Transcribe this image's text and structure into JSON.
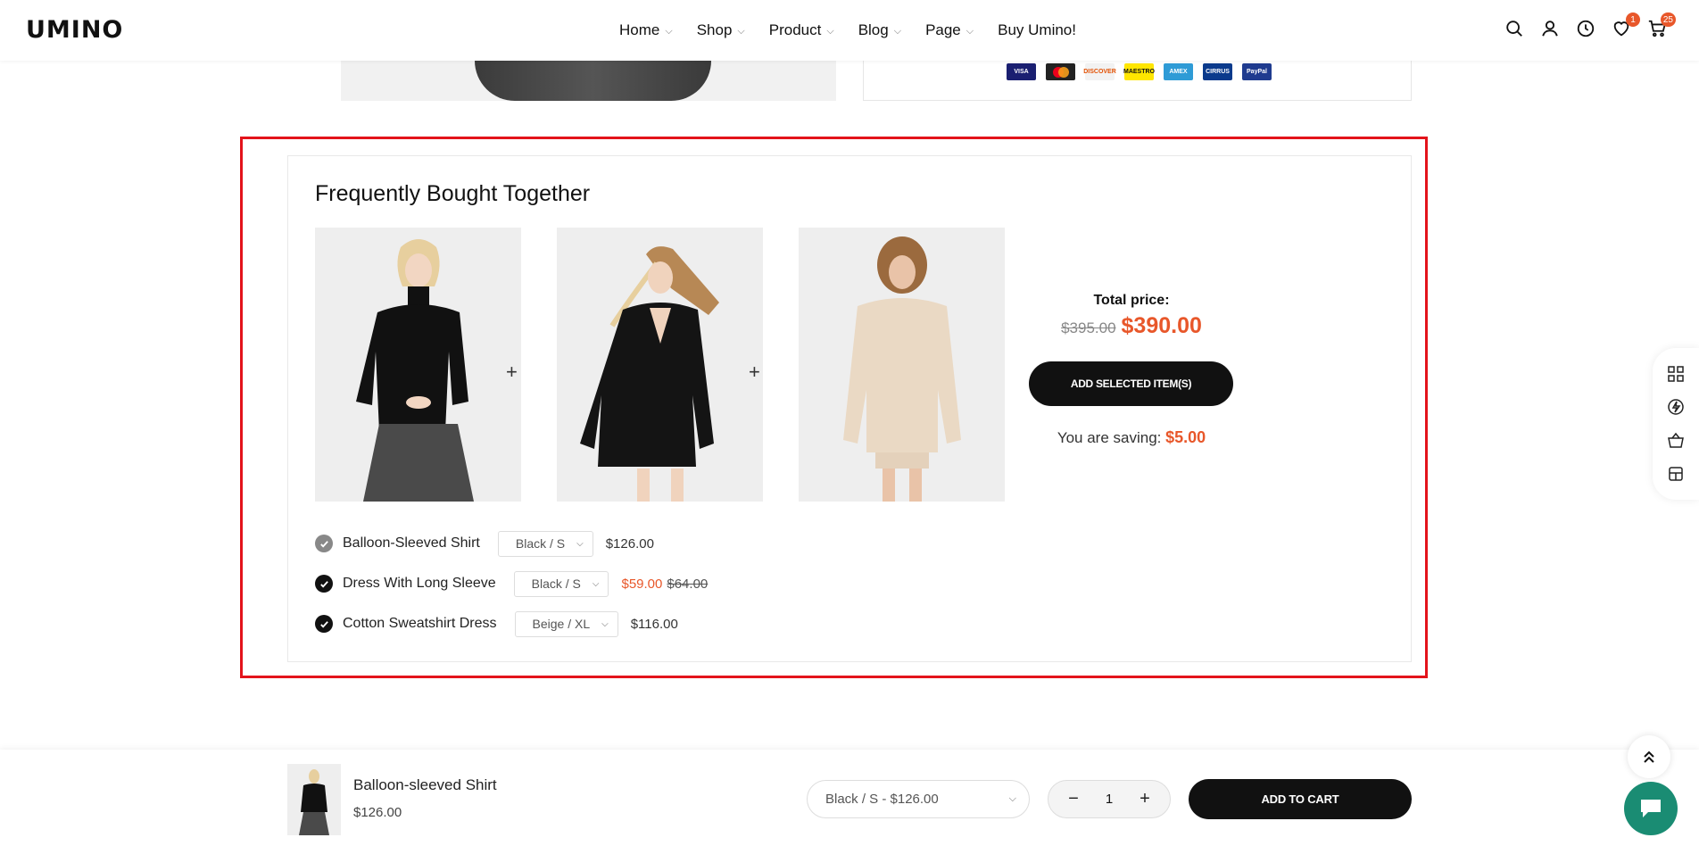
{
  "header": {
    "logo": "UMINO",
    "nav": [
      {
        "label": "Home"
      },
      {
        "label": "Shop"
      },
      {
        "label": "Product"
      },
      {
        "label": "Blog"
      },
      {
        "label": "Page"
      },
      {
        "label": "Buy Umino!"
      }
    ],
    "wishlist_count": "1",
    "cart_count": "25"
  },
  "payments": [
    "VISA",
    "MC",
    "DISCOVER",
    "MAESTRO",
    "AMEX",
    "CIRRUS",
    "PayPal"
  ],
  "fbt": {
    "title": "Frequently Bought Together",
    "total_label": "Total price:",
    "total_old": "$395.00",
    "total_new": "$390.00",
    "add_selected": "ADD SELECTED ITEM(S)",
    "saving_label": "You are saving:",
    "saving_amount": "$5.00",
    "items": [
      {
        "name": "Balloon-Sleeved Shirt",
        "variant": "Black / S",
        "price": "$126.00"
      },
      {
        "name": "Dress With Long Sleeve",
        "variant": "Black / S",
        "sale": "$59.00",
        "compare": "$64.00"
      },
      {
        "name": "Cotton Sweatshirt Dress",
        "variant": "Beige / XL",
        "price": "$116.00"
      }
    ]
  },
  "sticky": {
    "name": "Balloon-sleeved Shirt",
    "price": "$126.00",
    "variant": "Black / S - $126.00",
    "qty": "1",
    "add_to_cart": "ADD TO CART"
  },
  "colors": {
    "accent": "#e8572a",
    "dark": "#111111",
    "chat": "#1a8c73",
    "highlight": "#e3131b"
  }
}
